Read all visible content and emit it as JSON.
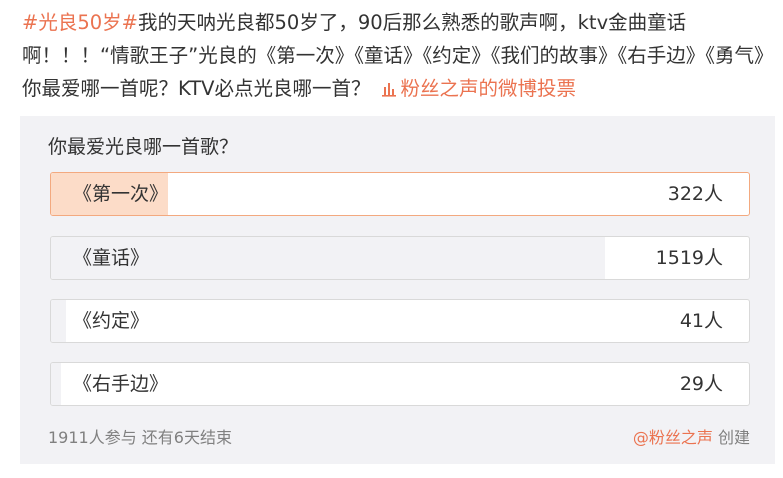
{
  "post": {
    "hashtag": "#光良50岁#",
    "text": "我的天呐光良都50岁了，90后那么熟悉的歌声啊，ktv金曲童话啊！！！“情歌王子”光良的《第一次》《童话》《约定》《我们的故事》《右手边》《勇气》你最爱哪一首呢？KTV必点光良哪一首？",
    "vote_link": "粉丝之声的微博投票",
    "vote_icon": "bar-chart-icon"
  },
  "poll": {
    "question": "你最爱光良哪一首歌？",
    "options": [
      {
        "label": "《第一次》",
        "count": "322人",
        "fraction": 0.168,
        "selected": true
      },
      {
        "label": "《童话》",
        "count": "1519人",
        "fraction": 0.793,
        "selected": false
      },
      {
        "label": "《约定》",
        "count": "41人",
        "fraction": 0.021,
        "selected": false
      },
      {
        "label": "《右手边》",
        "count": "29人",
        "fraction": 0.015,
        "selected": false
      }
    ],
    "stats": "1911人参与 还有6天结束",
    "creator_link": "@粉丝之声",
    "creator_suffix": " 创建"
  },
  "colors": {
    "accent": "#eb7350",
    "selected_fill": "#fcdcc8",
    "selected_border": "#f3a97f",
    "card_bg": "#f2f2f5"
  }
}
